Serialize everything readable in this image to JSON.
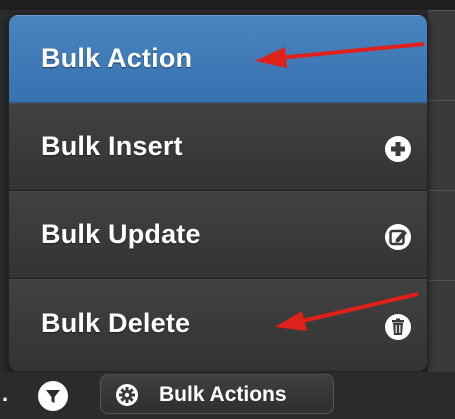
{
  "menu": {
    "items": [
      {
        "label": "Bulk Action",
        "icon": ""
      },
      {
        "label": "Bulk Insert",
        "icon": "plus-circle-icon"
      },
      {
        "label": "Bulk Update",
        "icon": "edit-icon"
      },
      {
        "label": "Bulk Delete",
        "icon": "trash-icon"
      }
    ],
    "active_color": "#3b77b6"
  },
  "toolbar": {
    "ellipsis": ".",
    "filter_icon": "filter-icon",
    "bulk_button_label": "Bulk Actions",
    "bulk_button_icon": "gear-icon"
  },
  "annotations": {
    "arrow_color": "#e0201a"
  }
}
